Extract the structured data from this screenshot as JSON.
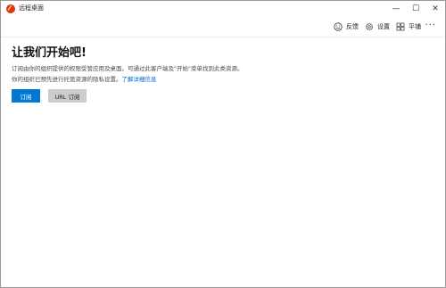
{
  "window": {
    "title": "远程桌面",
    "controls": {
      "minimize": "—",
      "maximize": "☐",
      "close": "✕"
    }
  },
  "toolbar": {
    "feedback_label": "反馈",
    "settings_label": "设置",
    "tile_label": "平铺",
    "more_label": "···"
  },
  "main": {
    "heading": "让我们开始吧!",
    "line1": "订阅由你的组织提供的权限受管应用及桌面。可通过此客户端及\"开始\"菜单找到此类资源。",
    "line2_text": "你的组织已预先进行托管资源的隐私设置。",
    "line2_link": "了解详细信息"
  },
  "buttons": {
    "subscribe": "订阅",
    "url_subscribe": "URL 订阅"
  },
  "colors": {
    "accent": "#0078d4",
    "link": "#0067c0",
    "app_icon": "#d83b01"
  }
}
